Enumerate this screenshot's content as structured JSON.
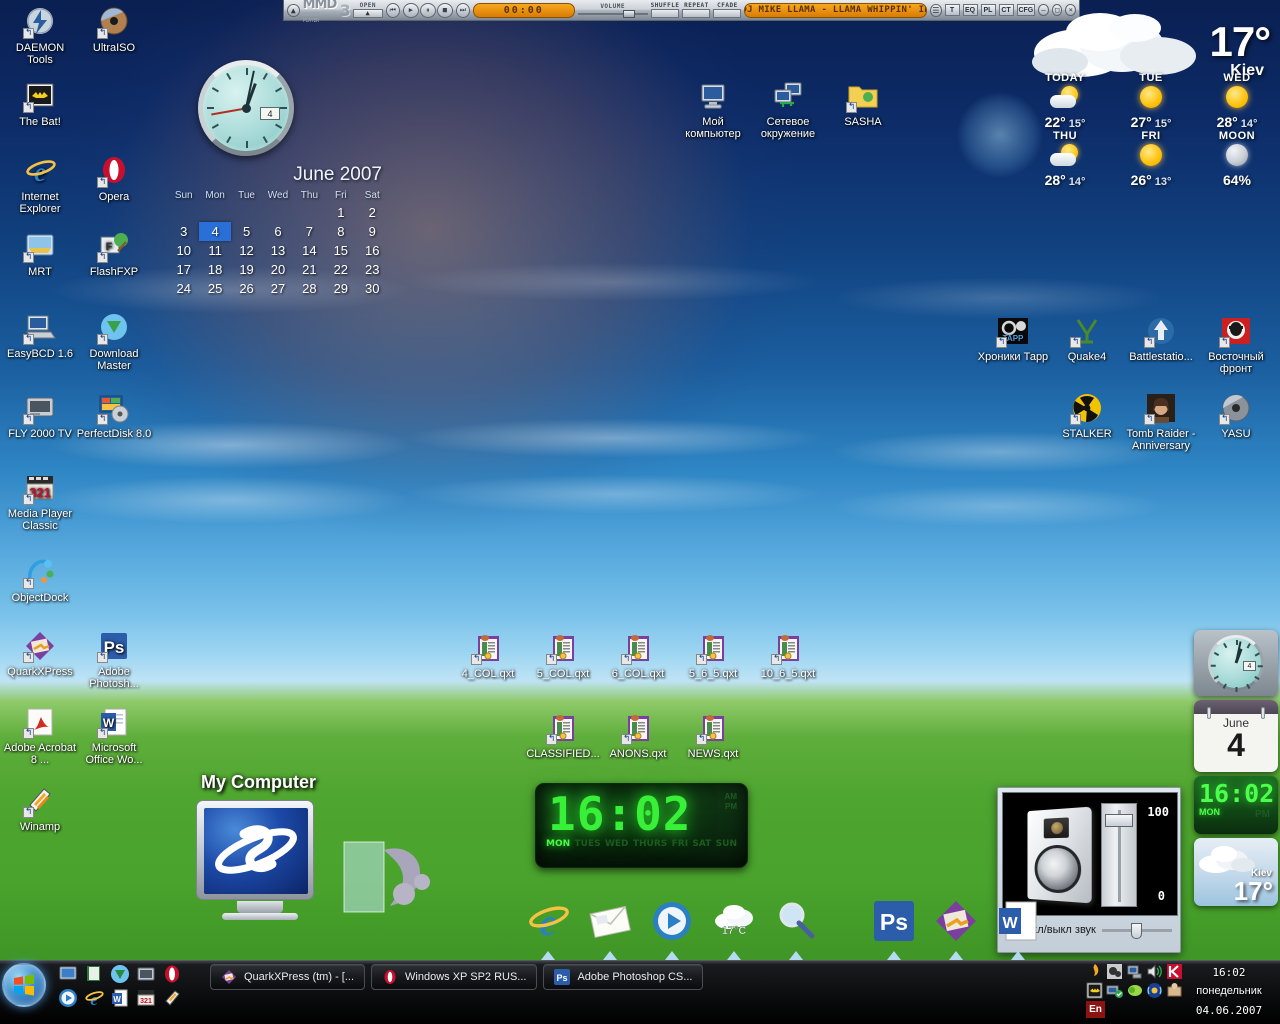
{
  "winamp": {
    "brand": "MMD",
    "brand_num": "3",
    "brand_sub": "WINAMP-PLAYER",
    "open_label": "OPEN",
    "open_btn": "▲",
    "time": "00:00",
    "volume_label": "VOLUME",
    "toggles": [
      "SHUFFLE",
      "REPEAT",
      "CFADE"
    ],
    "track_title": "DJ MIKE LLAMA - LLAMA WHIPPIN' IN",
    "eq_buttons": [
      "T",
      "EQ",
      "PL",
      "CT",
      "CFG"
    ],
    "transport": {
      "prev": "⏮",
      "play": "▶",
      "pause": "⏸",
      "stop": "■",
      "next": "⏭"
    },
    "window_buttons": [
      "–",
      "□",
      "×"
    ],
    "playlist_icon": "☰"
  },
  "calendar_gadget": {
    "title": "June 2007",
    "weekdays": [
      "Sun",
      "Mon",
      "Tue",
      "Wed",
      "Thu",
      "Fri",
      "Sat"
    ],
    "weeks": [
      [
        "",
        "",
        "",
        "",
        "",
        "1",
        "2"
      ],
      [
        "3",
        "4",
        "5",
        "6",
        "7",
        "8",
        "9"
      ],
      [
        "10",
        "11",
        "12",
        "13",
        "14",
        "15",
        "16"
      ],
      [
        "17",
        "18",
        "19",
        "20",
        "21",
        "22",
        "23"
      ],
      [
        "24",
        "25",
        "26",
        "27",
        "28",
        "29",
        "30"
      ]
    ],
    "today": "4",
    "clock_date": "4"
  },
  "weather": {
    "current_temp": "17°",
    "city": "Kiev",
    "forecast": [
      {
        "day": "TODAY",
        "icon": "partly",
        "hi": "22°",
        "lo": "15°"
      },
      {
        "day": "TUE",
        "icon": "sun",
        "hi": "27°",
        "lo": "15°"
      },
      {
        "day": "WED",
        "icon": "sun",
        "hi": "28°",
        "lo": "14°"
      },
      {
        "day": "THU",
        "icon": "partly",
        "hi": "28°",
        "lo": "14°"
      },
      {
        "day": "FRI",
        "icon": "sun",
        "hi": "26°",
        "lo": "13°"
      },
      {
        "day": "MOON",
        "icon": "moon",
        "hi": "64%",
        "lo": ""
      }
    ]
  },
  "desktop_icons_left": [
    {
      "label": "DAEMON Tools",
      "name": "daemon-tools"
    },
    {
      "label": "UltraISO",
      "name": "ultraiso"
    },
    {
      "label": "The Bat!",
      "name": "the-bat"
    },
    {
      "label": "Internet Explorer",
      "name": "internet-explorer"
    },
    {
      "label": "Opera",
      "name": "opera"
    },
    {
      "label": "MRT",
      "name": "mrt"
    },
    {
      "label": "FlashFXP",
      "name": "flashfxp"
    },
    {
      "label": "EasyBCD 1.6",
      "name": "easybcd"
    },
    {
      "label": "Download Master",
      "name": "download-master"
    },
    {
      "label": "FLY 2000 TV",
      "name": "fly-2000-tv"
    },
    {
      "label": "PerfectDisk 8.0",
      "name": "perfectdisk"
    },
    {
      "label": "Media Player Classic",
      "name": "media-player-classic"
    },
    {
      "label": "ObjectDock",
      "name": "objectdock"
    },
    {
      "label": "QuarkXPress",
      "name": "quarkxpress"
    },
    {
      "label": "Adobe Photosh...",
      "name": "adobe-photoshop"
    },
    {
      "label": "Adobe Acrobat 8 ...",
      "name": "adobe-acrobat"
    },
    {
      "label": "Microsoft Office Wo...",
      "name": "microsoft-word"
    },
    {
      "label": "Winamp",
      "name": "winamp"
    }
  ],
  "desktop_icons_top": [
    {
      "label": "Мой компьютер",
      "name": "my-computer"
    },
    {
      "label": "Сетевое окружение",
      "name": "network-neighborhood"
    },
    {
      "label": "SASHA",
      "name": "sasha-folder"
    }
  ],
  "desktop_icons_games": [
    {
      "label": "Хроники Тарр",
      "name": "hroniki-tarr"
    },
    {
      "label": "Quake4",
      "name": "quake4"
    },
    {
      "label": "Battlestatio...",
      "name": "battlestations"
    },
    {
      "label": "Восточный фронт",
      "name": "vostochny-front"
    },
    {
      "label": "STALKER",
      "name": "stalker"
    },
    {
      "label": "Tomb Raider - Anniversary",
      "name": "tomb-raider"
    },
    {
      "label": "YASU",
      "name": "yasu"
    }
  ],
  "desktop_files": [
    {
      "label": "4_COL.qxt",
      "name": "file-4-col"
    },
    {
      "label": "5_COL.qxt",
      "name": "file-5-col"
    },
    {
      "label": "6_COL.qxt",
      "name": "file-6-col"
    },
    {
      "label": "5_6_5.qxt",
      "name": "file-5-6-5"
    },
    {
      "label": "10_6_5.qxt",
      "name": "file-10-6-5"
    },
    {
      "label": "CLASSIFIED...",
      "name": "file-classified"
    },
    {
      "label": "ANONS.qxt",
      "name": "file-anons"
    },
    {
      "label": "NEWS.qxt",
      "name": "file-news"
    }
  ],
  "digital_clock": {
    "time": "16:02",
    "days": [
      "MON",
      "TUES",
      "WED",
      "THURS",
      "FRI",
      "SAT",
      "SUN"
    ],
    "active_day": "MON",
    "am": "AM",
    "pm": "PM"
  },
  "sidebar": {
    "clock_date": "4",
    "cal_month": "June",
    "cal_day": "4",
    "digi_time": "16:02",
    "digi_day": "MON",
    "digi_pm": "PM",
    "weather_city": "Kiev",
    "weather_temp": "17°"
  },
  "volume_panel": {
    "max_label": "100",
    "min_label": "0",
    "mute_label": "Вкл/выкл звук"
  },
  "mycomputer": {
    "label": "My Computer"
  },
  "dock": [
    {
      "name": "internet-explorer-dock",
      "label": ""
    },
    {
      "name": "mail-dock",
      "label": ""
    },
    {
      "name": "media-player-dock",
      "label": ""
    },
    {
      "name": "weather-dock",
      "label": "17°C"
    },
    {
      "name": "search-dock",
      "label": ""
    },
    {
      "name": "photoshop-dock",
      "label": "Ps"
    },
    {
      "name": "quarkxpress-dock",
      "label": ""
    },
    {
      "name": "word-dock",
      "label": ""
    }
  ],
  "taskbar": {
    "start_label": "",
    "tasks": [
      {
        "label": "QuarkXPress (tm) - [...",
        "name": "taskbtn-quarkxpress",
        "icon": "quark"
      },
      {
        "label": "Windows XP SP2 RUS...",
        "name": "taskbtn-opera",
        "icon": "opera"
      },
      {
        "label": "Adobe Photoshop CS...",
        "name": "taskbtn-photoshop",
        "icon": "ps"
      }
    ],
    "tray": {
      "time": "16:02",
      "weekday": "понедельник",
      "date": "04.06.2007",
      "language": "En"
    }
  },
  "colors": {
    "accent_orange": "#f7a81e",
    "taskbar_black": "#0d0e10",
    "calendar_today": "#2a6fd8",
    "lcd_green": "#39f039"
  }
}
